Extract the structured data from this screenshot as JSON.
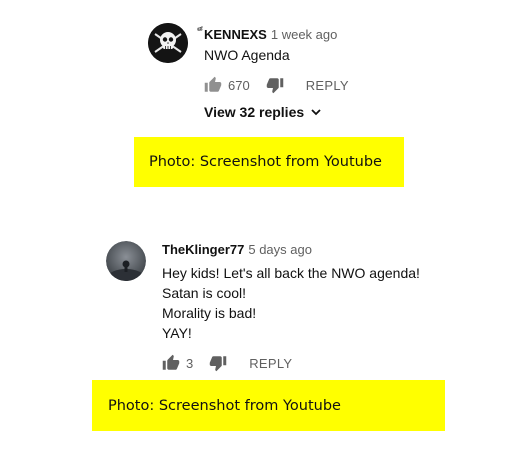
{
  "comments": [
    {
      "author": "็KENNEXS",
      "time": "1 week ago",
      "text_lines": [
        "NWO Agenda"
      ],
      "likes": "670",
      "reply_label": "REPLY",
      "view_replies": "View 32 replies"
    },
    {
      "author": "TheKlinger77",
      "time": "5 days ago",
      "text_lines": [
        "Hey kids! Let's all back the NWO agenda!",
        "Satan is cool!",
        "Morality is bad!",
        "YAY!"
      ],
      "likes": "3",
      "reply_label": "REPLY"
    }
  ],
  "captions": [
    "Photo: Screenshot from Youtube",
    "Photo: Screenshot from Youtube"
  ],
  "icons": {
    "like": "thumbs-up-icon",
    "dislike": "thumbs-down-icon",
    "expand": "chevron-down-icon",
    "avatar1": "jolly-roger-skull-icon"
  }
}
